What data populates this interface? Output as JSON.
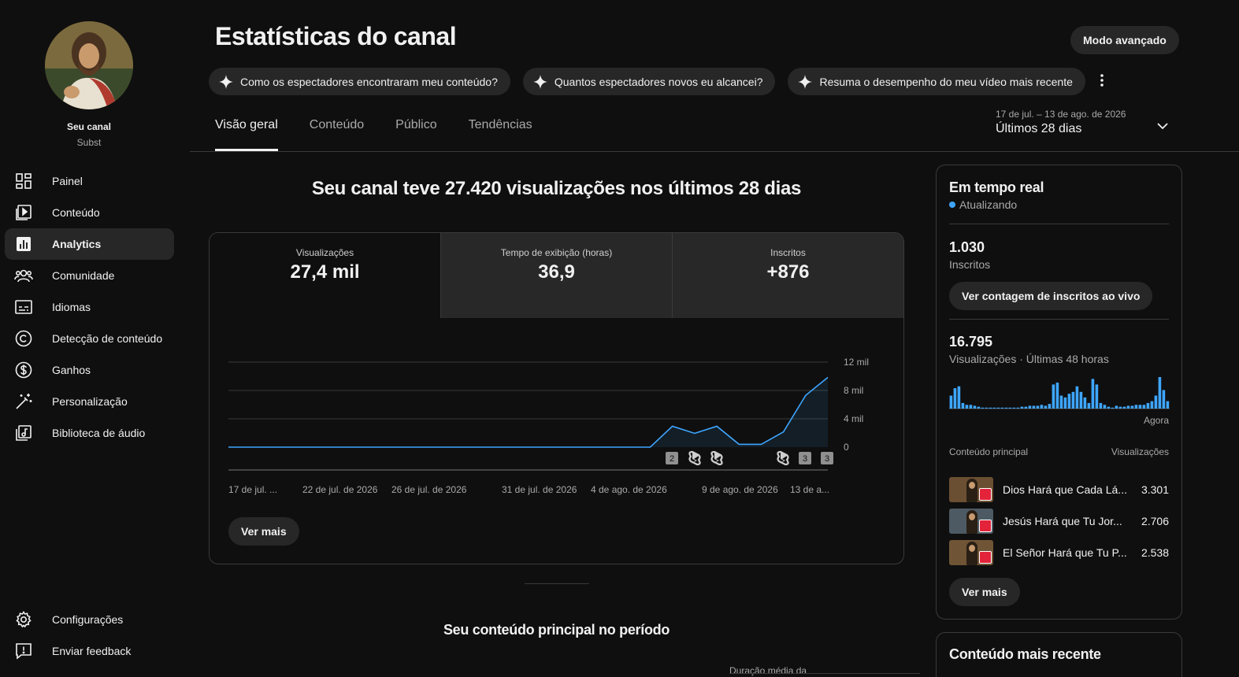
{
  "channel": {
    "name": "Seu canal",
    "subtitle": "Subst"
  },
  "nav": {
    "top": [
      {
        "label": "Painel",
        "icon": "dashboard-icon"
      },
      {
        "label": "Conteúdo",
        "icon": "content-icon"
      },
      {
        "label": "Analytics",
        "icon": "analytics-icon",
        "active": true
      },
      {
        "label": "Comunidade",
        "icon": "community-icon"
      },
      {
        "label": "Idiomas",
        "icon": "subtitles-icon"
      },
      {
        "label": "Detecção de conteúdo",
        "icon": "copyright-icon"
      },
      {
        "label": "Ganhos",
        "icon": "dollar-icon"
      },
      {
        "label": "Personalização",
        "icon": "magic-wand-icon"
      },
      {
        "label": "Biblioteca de áudio",
        "icon": "audio-library-icon"
      }
    ],
    "bottom": [
      {
        "label": "Configurações",
        "icon": "gear-icon"
      },
      {
        "label": "Enviar feedback",
        "icon": "feedback-icon"
      }
    ]
  },
  "header": {
    "title": "Estatísticas do canal",
    "advanced_label": "Modo avançado",
    "chips": [
      "Como os espectadores encontraram meu conteúdo?",
      "Quantos espectadores novos eu alcancei?",
      "Resuma o desempenho do meu vídeo mais recente"
    ]
  },
  "tabs": [
    "Visão geral",
    "Conteúdo",
    "Público",
    "Tendências"
  ],
  "date": {
    "range": "17 de jul. – 13 de ago. de 2026",
    "label": "Últimos 28 dias"
  },
  "overview": {
    "headline": "Seu canal teve 27.420 visualizações nos últimos 28 dias",
    "metrics": [
      {
        "label": "Visualizações",
        "value": "27,4 mil"
      },
      {
        "label": "Tempo de exibição (horas)",
        "value": "36,9"
      },
      {
        "label": "Inscritos",
        "value": "+876"
      }
    ],
    "see_more": "Ver mais",
    "section2_title": "Seu conteúdo principal no período",
    "cut_label": "Duração média da"
  },
  "chart_data": {
    "type": "line",
    "x": [
      "17 de jul.",
      "18 de jul.",
      "19 de jul.",
      "20 de jul.",
      "21 de jul.",
      "22 de jul.",
      "23 de jul.",
      "24 de jul.",
      "25 de jul.",
      "26 de jul.",
      "27 de jul.",
      "28 de jul.",
      "29 de jul.",
      "30 de jul.",
      "31 de jul.",
      "1 de ago.",
      "2 de ago.",
      "3 de ago.",
      "4 de ago.",
      "5 de ago.",
      "6 de ago.",
      "7 de ago.",
      "8 de ago.",
      "9 de ago.",
      "10 de ago.",
      "11 de ago.",
      "12 de ago.",
      "13 de ago."
    ],
    "series": [
      {
        "values": [
          0,
          0,
          0,
          0,
          0,
          0,
          0,
          0,
          0,
          0,
          0,
          0,
          0,
          0,
          0,
          0,
          0,
          0,
          0,
          0,
          2950,
          1950,
          2950,
          400,
          400,
          2150,
          7300,
          9850
        ]
      }
    ],
    "x_tick_labels": [
      "17 de jul. ...",
      "22 de jul. de 2026",
      "26 de jul. de 2026",
      "31 de jul. de 2026",
      "4 de ago. de 2026",
      "9 de ago. de 2026",
      "13 de a..."
    ],
    "y_tick_labels": [
      "0",
      "4 mil",
      "8 mil",
      "12 mil"
    ],
    "ylim": [
      0,
      12000
    ],
    "grid": true,
    "color": "#3ea6ff",
    "markers": [
      "2",
      "shorts",
      "shorts",
      "shorts",
      "3",
      "3"
    ]
  },
  "realtime": {
    "title": "Em tempo real",
    "status": "Atualizando",
    "subs_value": "1.030",
    "subs_label": "Inscritos",
    "live_button": "Ver contagem de inscritos ao vivo",
    "views_value": "16.795",
    "views_label": "Visualizações · Últimas 48 horas",
    "bars": [
      14,
      22,
      24,
      6,
      4,
      4,
      3,
      2,
      1,
      1,
      1,
      1,
      1,
      1,
      1,
      1,
      1,
      1,
      2,
      2,
      3,
      3,
      3,
      4,
      3,
      5,
      26,
      28,
      14,
      12,
      16,
      18,
      24,
      18,
      12,
      6,
      32,
      26,
      6,
      4,
      2,
      1,
      3,
      2,
      2,
      3,
      3,
      4,
      4,
      4,
      6,
      8,
      14,
      34,
      20,
      8
    ],
    "now_label": "Agora",
    "col_content": "Conteúdo principal",
    "col_views": "Visualizações",
    "items": [
      {
        "title": "Dios Hará que Cada Lá...",
        "views": "3.301"
      },
      {
        "title": "Jesús Hará que Tu Jor...",
        "views": "2.706"
      },
      {
        "title": "El Señor Hará que Tu P...",
        "views": "2.538"
      }
    ],
    "see_more": "Ver mais"
  },
  "recent": {
    "title": "Conteúdo mais recente"
  },
  "colors": {
    "accent": "#3ea6ff",
    "background": "#0f0f0f",
    "surface": "#272727"
  }
}
